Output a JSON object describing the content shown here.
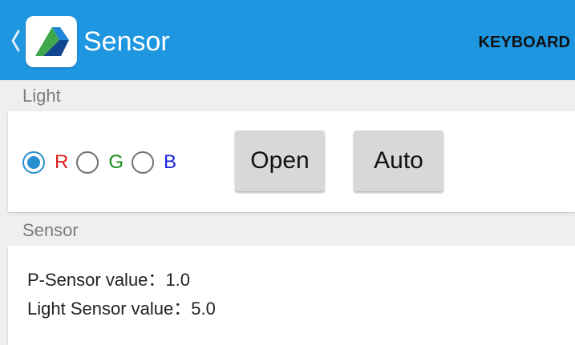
{
  "app_bar": {
    "title": "Sensor",
    "action_label": "KEYBOARD",
    "background_color": "#1e96e0",
    "icons": {
      "back": "chevron-left-icon",
      "app": "app-logo-icon"
    }
  },
  "light_section": {
    "header": "Light",
    "radios": [
      {
        "label": "R",
        "color": "#e02020",
        "checked": true
      },
      {
        "label": "G",
        "color": "#1a8f1a",
        "checked": false
      },
      {
        "label": "B",
        "color": "#1a25d8",
        "checked": false
      }
    ],
    "buttons": {
      "open_label": "Open",
      "auto_label": "Auto"
    }
  },
  "sensor_section": {
    "header": "Sensor",
    "p_sensor_label": "P-Sensor value：",
    "p_sensor_value": "1.0",
    "light_sensor_label": "Light Sensor value：",
    "light_sensor_value": "5.0"
  }
}
